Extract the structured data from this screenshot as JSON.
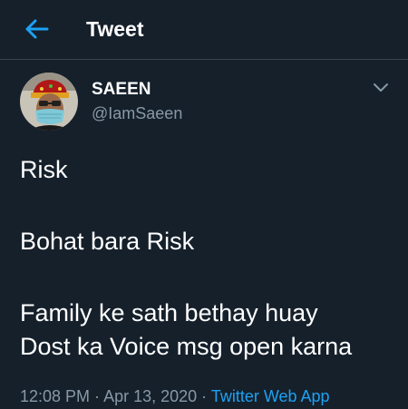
{
  "header": {
    "title": "Tweet",
    "back_icon": "arrow-left-icon",
    "accent_color": "#1da1f2"
  },
  "author": {
    "display_name": "SAEEN",
    "handle": "@IamSaeen",
    "avatar_icon": "avatar-masked-person"
  },
  "tweet": {
    "line1": "Risk",
    "line2": "Bohat bara Risk",
    "line3": "Family ke sath bethay huay",
    "line4": "Dost ka Voice msg open karna"
  },
  "meta": {
    "time": "12:08 PM",
    "sep1": " · ",
    "date": "Apr 13, 2020",
    "sep2": " · ",
    "source": "Twitter Web App"
  },
  "colors": {
    "background": "#15202b",
    "secondary_text": "#8899a6",
    "divider": "#38444d"
  }
}
